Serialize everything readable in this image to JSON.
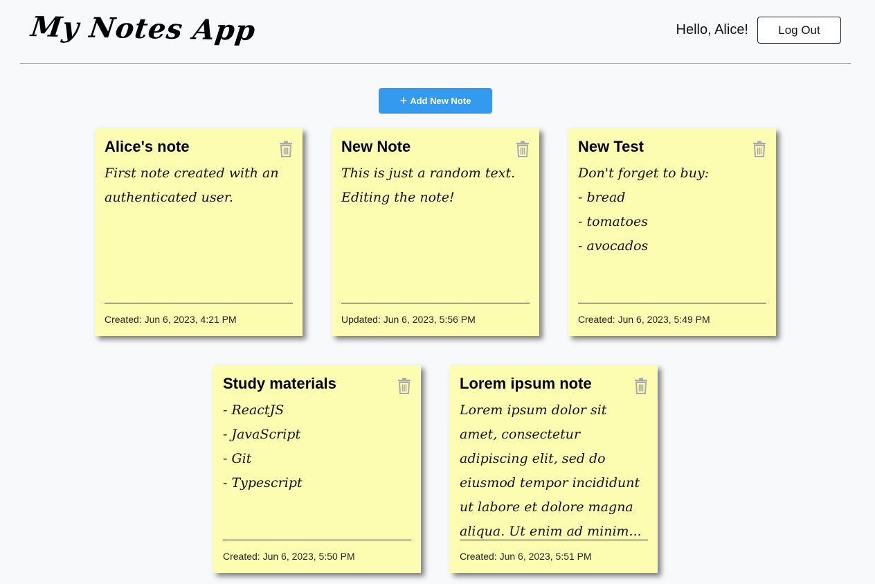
{
  "header": {
    "logo": "My Notes App",
    "greeting": "Hello, Alice!",
    "logout_label": "Log Out"
  },
  "toolbar": {
    "add_icon": "+",
    "add_label": "Add New Note"
  },
  "colors": {
    "note_bg": "#fdfdb2",
    "accent": "#339af0",
    "trash_icon": "#aaaaaa"
  },
  "notes": [
    {
      "title": "Alice's note",
      "lines": [
        "First note created with an",
        "authenticated user."
      ],
      "footer": "Created: Jun 6, 2023, 4:21 PM"
    },
    {
      "title": "New Note",
      "lines": [
        "This is just a random text.",
        "Editing the note!"
      ],
      "footer": "Updated: Jun 6, 2023, 5:56 PM"
    },
    {
      "title": "New Test",
      "lines": [
        "Don't forget to buy:",
        "- bread",
        "- tomatoes",
        "- avocados"
      ],
      "footer": "Created: Jun 6, 2023, 5:49 PM"
    },
    {
      "title": "Study materials",
      "lines": [
        "- ReactJS",
        "- JavaScript",
        "- Git",
        "- Typescript"
      ],
      "footer": "Created: Jun 6, 2023, 5:50 PM"
    },
    {
      "title": "Lorem ipsum note",
      "lines": [
        "Lorem ipsum dolor sit",
        "amet, consectetur",
        "adipiscing elit, sed do",
        "eiusmod tempor incididunt",
        "ut labore et dolore magna",
        "aliqua. Ut enim ad minim..."
      ],
      "footer": "Created: Jun 6, 2023, 5:51 PM"
    }
  ]
}
